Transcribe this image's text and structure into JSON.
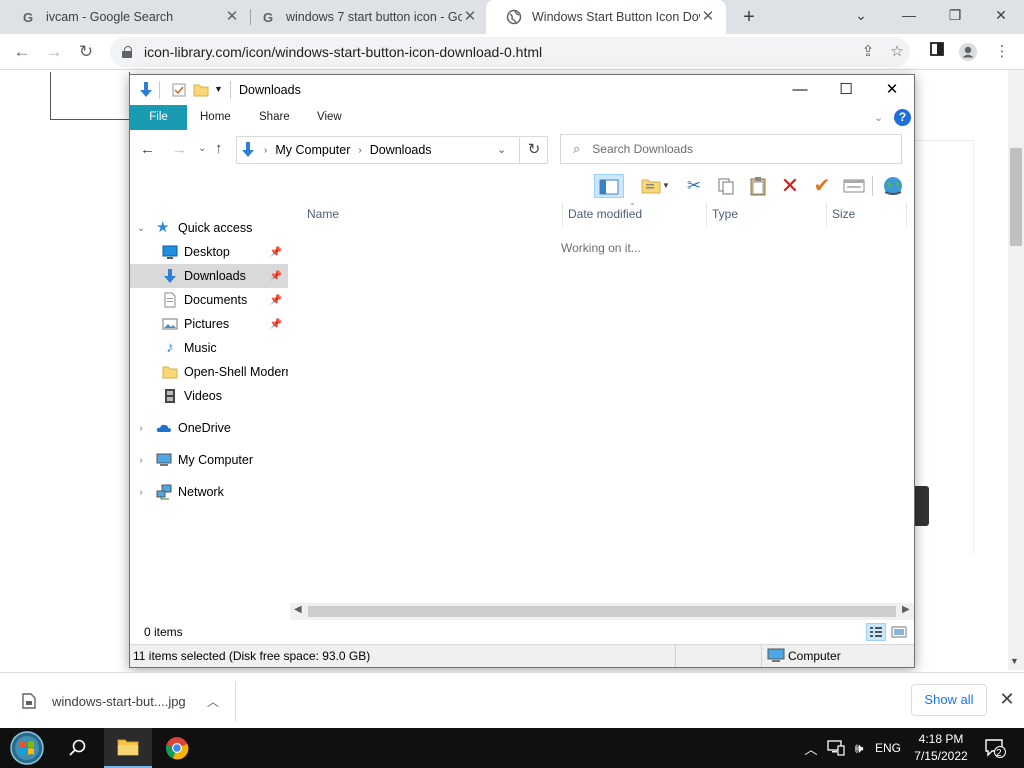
{
  "browser": {
    "tabs": [
      {
        "title": "ivcam - Google Search",
        "active": false
      },
      {
        "title": "windows 7 start button icon - Go",
        "active": false
      },
      {
        "title": "Windows Start Button Icon Down",
        "active": true
      }
    ],
    "url": "icon-library.com/icon/windows-start-button-icon-download-0.html"
  },
  "explorer": {
    "title": "Downloads",
    "ribbon_tabs": [
      "File",
      "Home",
      "Share",
      "View"
    ],
    "breadcrumb": [
      "My Computer",
      "Downloads"
    ],
    "search_placeholder": "Search Downloads",
    "columns": [
      "Name",
      "Date modified",
      "Type",
      "Size"
    ],
    "working_text": "Working on it...",
    "nav": {
      "quick_access": "Quick access",
      "pinned": [
        {
          "label": "Desktop",
          "icon": "desktop-icon"
        },
        {
          "label": "Downloads",
          "icon": "downloads-icon",
          "selected": true
        },
        {
          "label": "Documents",
          "icon": "documents-icon"
        },
        {
          "label": "Pictures",
          "icon": "pictures-icon"
        }
      ],
      "other": [
        {
          "label": "Music",
          "icon": "music-icon"
        },
        {
          "label": "Open-Shell Modern",
          "icon": "folder-icon"
        },
        {
          "label": "Videos",
          "icon": "videos-icon"
        }
      ],
      "roots": [
        "OneDrive",
        "My Computer",
        "Network"
      ]
    },
    "item_count": "0 items",
    "status_selected": "11 items selected (Disk free space: 93.0 GB)",
    "status_location": "Computer"
  },
  "download_bar": {
    "file": "windows-start-but....jpg",
    "show_all": "Show all"
  },
  "taskbar": {
    "language": "ENG",
    "time": "4:18 PM",
    "date": "7/15/2022",
    "notifications": "2"
  },
  "colors": {
    "file_tab": "#1a9bb4",
    "accent_blue": "#1a73e8",
    "taskbar": "#101010"
  }
}
